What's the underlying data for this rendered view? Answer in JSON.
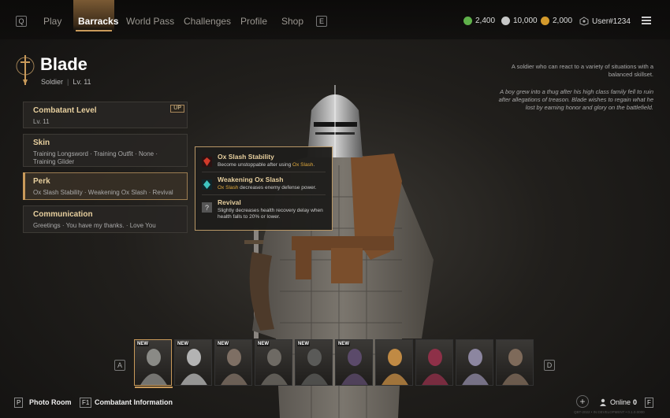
{
  "nav": {
    "left_key": "Q",
    "right_key": "E",
    "items": [
      "Play",
      "Barracks",
      "World Pass",
      "Challenges",
      "Profile",
      "Shop"
    ],
    "active": "Barracks"
  },
  "currency": [
    {
      "icon": "green-gem-icon",
      "value": "2,400",
      "color": "#5fb04a"
    },
    {
      "icon": "silver-coin-icon",
      "value": "10,000",
      "color": "#c7c7c7"
    },
    {
      "icon": "gold-coin-icon",
      "value": "2,000",
      "color": "#d49a2c"
    }
  ],
  "user": {
    "name": "User#1234",
    "level_icon": "rank-badge-icon"
  },
  "character": {
    "name": "Blade",
    "class": "Soldier",
    "level": "Lv. 11"
  },
  "panels": {
    "combatant": {
      "title": "Combatant Level",
      "desc": "Lv. 11",
      "badge": "UP"
    },
    "skin": {
      "title": "Skin",
      "desc": "Training Longsword · Training Outfit · None · Training Glider"
    },
    "perk": {
      "title": "Perk",
      "desc": "Ox Slash Stability · Weakening Ox Slash · Revival"
    },
    "communication": {
      "title": "Communication",
      "desc": "Greetings · You have my thanks. · Love You"
    }
  },
  "tooltip": {
    "perks": [
      {
        "name": "Ox Slash Stability",
        "pre": "Become unstoppable after using ",
        "hl": "Ox Slash",
        "post": ".",
        "icon": "red-crystal-icon"
      },
      {
        "name": "Weakening Ox Slash",
        "pre": "",
        "hl": "Ox Slash",
        "post": " decreases enemy defense power.",
        "icon": "teal-crystal-icon"
      },
      {
        "name": "Revival",
        "pre": "Slightly decreases health recovery delay when health falls to 20% or lower.",
        "hl": "",
        "post": "",
        "icon": "question-icon"
      }
    ]
  },
  "lore": {
    "summary": "A soldier who can react to a variety of situations with a balanced skillset.",
    "story": "A boy grew into a thug after his high class family fell to ruin after allegations of treason. Blade wishes to regain what he lost by earning honor and glory on the battlefield."
  },
  "roster": {
    "left_key": "A",
    "right_key": "D",
    "cards": [
      {
        "new": "NEW",
        "tint": "#8a8a86"
      },
      {
        "new": "NEW",
        "tint": "#b3b3b3"
      },
      {
        "new": "NEW",
        "tint": "#7e6f64"
      },
      {
        "new": "NEW",
        "tint": "#6e6a64"
      },
      {
        "new": "NEW",
        "tint": "#5a5a58"
      },
      {
        "new": "NEW",
        "tint": "#5b4a6a"
      },
      {
        "new": "",
        "tint": "#c08a44"
      },
      {
        "new": "",
        "tint": "#8e3048"
      },
      {
        "new": "",
        "tint": "#8c86a0"
      },
      {
        "new": "",
        "tint": "#7e6a5a"
      }
    ]
  },
  "bottom": {
    "photo_key": "P",
    "photo_label": "Photo Room",
    "info_key": "F1",
    "info_label": "Combatant Information",
    "online_label": "Online",
    "online_count": "0",
    "f_key": "F",
    "build_info": "QBT-2022 • IN DEVELOPMENT • 0.1.0.0000"
  }
}
